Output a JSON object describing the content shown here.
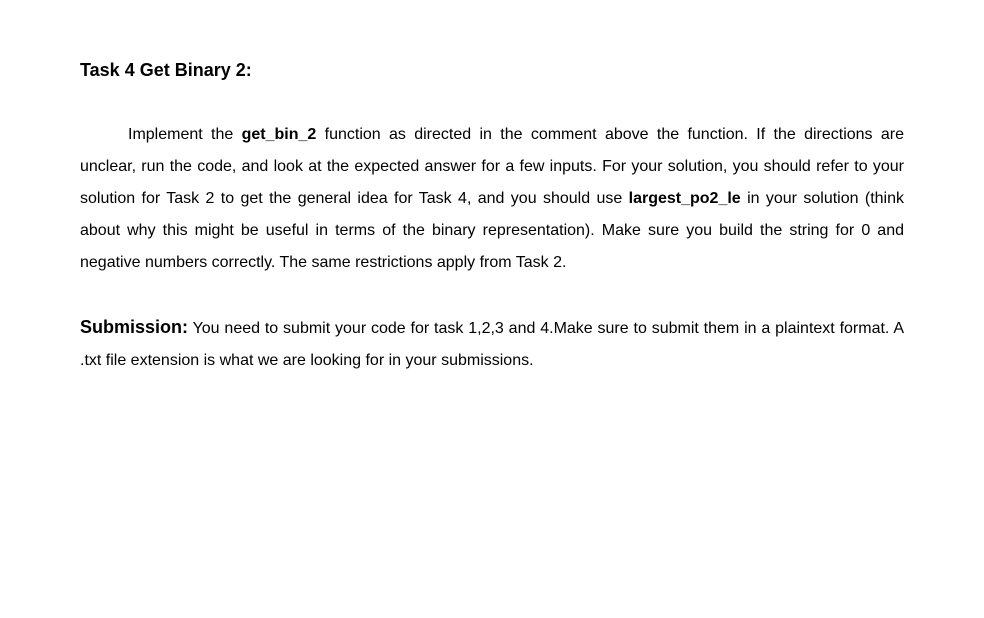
{
  "heading": "Task 4 Get Binary 2:",
  "para1": {
    "t1": "Implement the ",
    "b1": "get_bin_2",
    "t2": " function as directed in the comment above the function. If the directions are unclear, run the code, and look at the expected answer for a few inputs. For your solution, you should refer to your solution for Task 2 to get the general idea for Task 4, and you should use ",
    "b2": "largest_po2_le",
    "t3": " in your solution (think about why this might be useful in terms of the binary representation). Make sure you build the string for 0 and negative numbers correctly. The same restrictions apply from Task 2."
  },
  "para2": {
    "label": "Submission:",
    "text": " You need to submit your code for task 1,2,3 and 4.Make sure to submit them in a plaintext format. A .txt file extension is what we are looking for in your submissions."
  }
}
